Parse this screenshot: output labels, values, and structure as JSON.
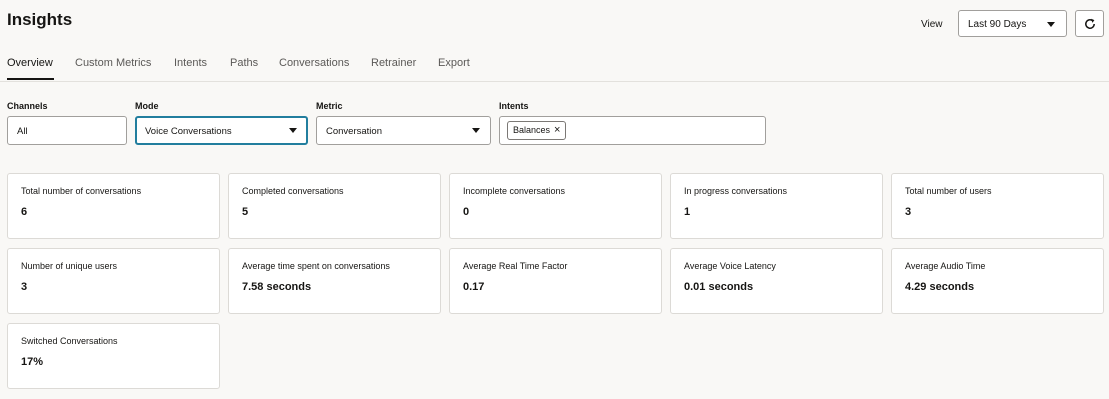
{
  "page": {
    "title": "Insights"
  },
  "view": {
    "label": "View",
    "selected": "Last 90 Days",
    "refresh_icon": "refresh-icon"
  },
  "tabs": [
    "Overview",
    "Custom Metrics",
    "Intents",
    "Paths",
    "Conversations",
    "Retrainer",
    "Export"
  ],
  "active_tab": "Overview",
  "filters": {
    "channels": {
      "label": "Channels",
      "value": "All"
    },
    "mode": {
      "label": "Mode",
      "value": "Voice Conversations"
    },
    "metric": {
      "label": "Metric",
      "value": "Conversation"
    },
    "intents": {
      "label": "Intents",
      "chips": [
        "Balances"
      ]
    }
  },
  "metrics": [
    {
      "label": "Total number of conversations",
      "value": "6"
    },
    {
      "label": "Completed conversations",
      "value": "5"
    },
    {
      "label": "Incomplete conversations",
      "value": "0"
    },
    {
      "label": "In progress conversations",
      "value": "1"
    },
    {
      "label": "Total number of users",
      "value": "3"
    },
    {
      "label": "Number of unique users",
      "value": "3"
    },
    {
      "label": "Average time spent on conversations",
      "value": "7.58 seconds"
    },
    {
      "label": "Average Real Time Factor",
      "value": "0.17"
    },
    {
      "label": "Average Voice Latency",
      "value": "0.01 seconds"
    },
    {
      "label": "Average Audio Time",
      "value": "4.29 seconds"
    },
    {
      "label": "Switched Conversations",
      "value": "17%"
    }
  ],
  "colors": {
    "focus_border": "#227e9e",
    "background": "#f9f8f6"
  }
}
